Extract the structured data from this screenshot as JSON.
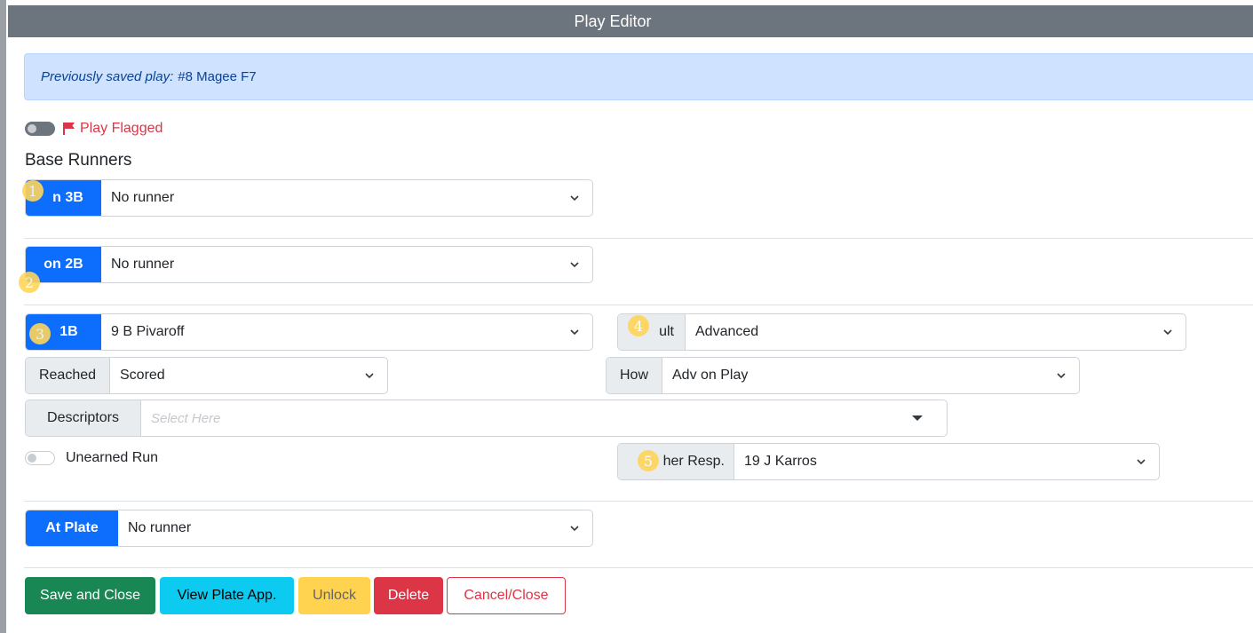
{
  "window": {
    "title": "Play Editor"
  },
  "alert": {
    "label": "Previously saved play:",
    "value": "#8 Magee F7"
  },
  "flag": {
    "label": "Play Flagged",
    "checked": false,
    "color": "#dc3545"
  },
  "base_runners": {
    "title": "Base Runners",
    "third": {
      "addon": "n 3B",
      "value": "No runner"
    },
    "second": {
      "addon": "on 2B",
      "value": "No runner"
    },
    "first": {
      "addon": "1B",
      "value": "9 B Pivaroff",
      "result": {
        "addon": "ult",
        "value": "Advanced"
      },
      "reached": {
        "addon": "Reached",
        "value": "Scored"
      },
      "how": {
        "addon": "How",
        "value": "Adv on Play"
      },
      "descriptors": {
        "addon": "Descriptors",
        "placeholder": "Select Here"
      },
      "unearned": {
        "label": "Unearned Run",
        "checked": false
      },
      "pitcher": {
        "addon": "her Resp.",
        "value": "19 J Karros"
      }
    },
    "plate": {
      "addon": "At Plate",
      "value": "No runner"
    }
  },
  "markers": [
    "1",
    "2",
    "3",
    "4",
    "5"
  ],
  "buttons": {
    "save": "Save and Close",
    "view": "View Plate App.",
    "unlock": "Unlock",
    "delete": "Delete",
    "cancel": "Cancel/Close"
  },
  "colors": {
    "primary": "#0d6efd",
    "success": "#198754",
    "info": "#0dcaf0",
    "warning": "#ffc107",
    "danger": "#dc3545",
    "title_bar": "#6c757d",
    "alert_bg": "#cfe2ff",
    "marker": "#ffd55a"
  }
}
